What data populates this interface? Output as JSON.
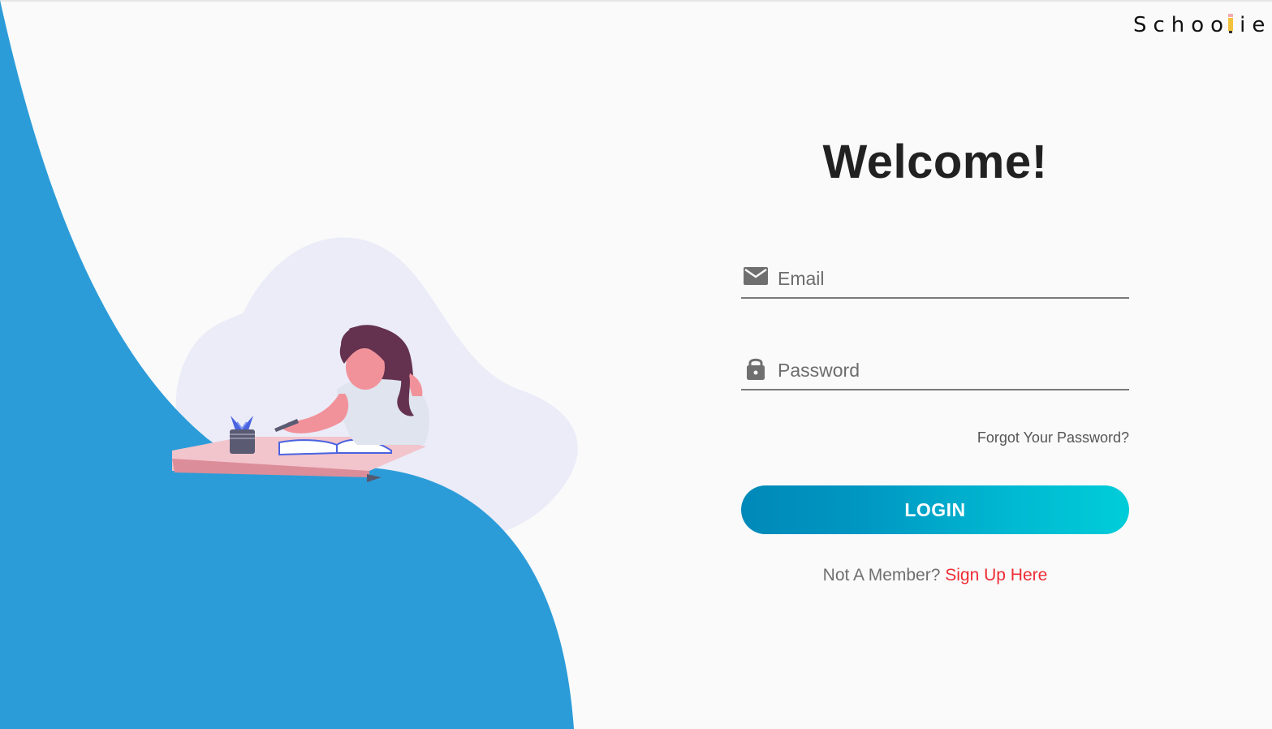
{
  "brand": {
    "name_before": "Schoo",
    "name_after": "ie"
  },
  "login": {
    "title": "Welcome!",
    "email_placeholder": "Email",
    "email_icon": "mail-icon",
    "password_placeholder": "Password",
    "password_icon": "lock-icon",
    "forgot_label": "Forgot Your Password?",
    "submit_label": "LOGIN",
    "signup_prompt": "Not A Member?",
    "signup_link": "Sign Up Here"
  },
  "illustration": {
    "subject": "woman-studying-at-desk"
  },
  "colors": {
    "hero_blue": "#2c9cd9",
    "blob": "#ebecf8",
    "button_start": "#0089b8",
    "button_end": "#00cdd9",
    "link_red": "#ee2c36",
    "title": "#212121"
  }
}
